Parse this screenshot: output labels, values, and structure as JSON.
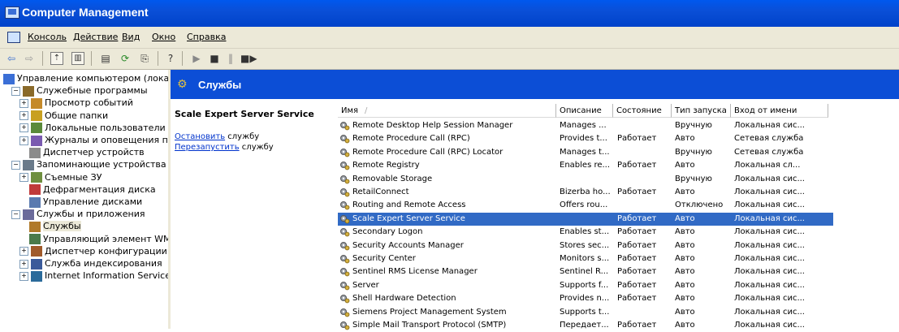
{
  "window": {
    "title": "Computer Management"
  },
  "menu": [
    "Консоль",
    "Действие",
    "Вид",
    "Окно",
    "Справка"
  ],
  "toolbar": {
    "icons": [
      "back-arrow-icon",
      "forward-arrow-icon",
      "up-folder-icon",
      "show-hide-tree-icon",
      "properties-icon",
      "refresh-icon",
      "export-list-icon",
      "help-icon",
      "play-icon",
      "stop-icon",
      "pause-icon",
      "restart-icon"
    ]
  },
  "tree": [
    {
      "label": "Управление компьютером (локаль",
      "indent": 0,
      "exp": ""
    },
    {
      "label": "Служебные программы",
      "indent": 1,
      "exp": "−"
    },
    {
      "label": "Просмотр событий",
      "indent": 2,
      "exp": "+"
    },
    {
      "label": "Общие папки",
      "indent": 2,
      "exp": "+"
    },
    {
      "label": "Локальные пользователи и",
      "indent": 2,
      "exp": "+"
    },
    {
      "label": "Журналы и оповещения пр",
      "indent": 2,
      "exp": "+"
    },
    {
      "label": "Диспетчер устройств",
      "indent": 2,
      "exp": ""
    },
    {
      "label": "Запоминающие устройства",
      "indent": 1,
      "exp": "−"
    },
    {
      "label": "Съемные ЗУ",
      "indent": 2,
      "exp": "+"
    },
    {
      "label": "Дефрагментация диска",
      "indent": 2,
      "exp": ""
    },
    {
      "label": "Управление дисками",
      "indent": 2,
      "exp": ""
    },
    {
      "label": "Службы и приложения",
      "indent": 1,
      "exp": "−"
    },
    {
      "label": "Службы",
      "indent": 2,
      "exp": "",
      "selected": true
    },
    {
      "label": "Управляющий элемент WM",
      "indent": 2,
      "exp": ""
    },
    {
      "label": "Диспетчер конфигурации S",
      "indent": 2,
      "exp": "+"
    },
    {
      "label": "Служба индексирования",
      "indent": 2,
      "exp": "+"
    },
    {
      "label": "Internet Information Service",
      "indent": 2,
      "exp": "+"
    }
  ],
  "header": {
    "title": "Службы"
  },
  "description": {
    "service_name": "Scale Expert Server Service",
    "stop_link": "Остановить",
    "stop_rest": " службу",
    "restart_link": "Перезапустить",
    "restart_rest": " службу"
  },
  "columns": [
    "Имя",
    "Описание",
    "Состояние",
    "Тип запуска",
    "Вход от имени"
  ],
  "services": [
    {
      "name": "Remote Desktop Help Session Manager",
      "desc": "Manages ...",
      "state": "",
      "startup": "Вручную",
      "logon": "Локальная сис..."
    },
    {
      "name": "Remote Procedure Call (RPC)",
      "desc": "Provides t...",
      "state": "Работает",
      "startup": "Авто",
      "logon": "Сетевая служба"
    },
    {
      "name": "Remote Procedure Call (RPC) Locator",
      "desc": "Manages t...",
      "state": "",
      "startup": "Вручную",
      "logon": "Сетевая служба"
    },
    {
      "name": "Remote Registry",
      "desc": "Enables re...",
      "state": "Работает",
      "startup": "Авто",
      "logon": "Локальная сл..."
    },
    {
      "name": "Removable Storage",
      "desc": "",
      "state": "",
      "startup": "Вручную",
      "logon": "Локальная сис..."
    },
    {
      "name": "RetailConnect",
      "desc": "Bizerba ho...",
      "state": "Работает",
      "startup": "Авто",
      "logon": "Локальная сис..."
    },
    {
      "name": "Routing and Remote Access",
      "desc": "Offers rou...",
      "state": "",
      "startup": "Отключено",
      "logon": "Локальная сис..."
    },
    {
      "name": "Scale Expert Server Service",
      "desc": "",
      "state": "Работает",
      "startup": "Авто",
      "logon": "Локальная сис...",
      "selected": true
    },
    {
      "name": "Secondary Logon",
      "desc": "Enables st...",
      "state": "Работает",
      "startup": "Авто",
      "logon": "Локальная сис..."
    },
    {
      "name": "Security Accounts Manager",
      "desc": "Stores sec...",
      "state": "Работает",
      "startup": "Авто",
      "logon": "Локальная сис..."
    },
    {
      "name": "Security Center",
      "desc": "Monitors s...",
      "state": "Работает",
      "startup": "Авто",
      "logon": "Локальная сис..."
    },
    {
      "name": "Sentinel RMS License Manager",
      "desc": "Sentinel R...",
      "state": "Работает",
      "startup": "Авто",
      "logon": "Локальная сис..."
    },
    {
      "name": "Server",
      "desc": "Supports f...",
      "state": "Работает",
      "startup": "Авто",
      "logon": "Локальная сис..."
    },
    {
      "name": "Shell Hardware Detection",
      "desc": "Provides n...",
      "state": "Работает",
      "startup": "Авто",
      "logon": "Локальная сис..."
    },
    {
      "name": "Siemens Project Management System",
      "desc": "Supports t...",
      "state": "",
      "startup": "Авто",
      "logon": "Локальная сис..."
    },
    {
      "name": "Simple Mail Transport Protocol (SMTP)",
      "desc": "Передает...",
      "state": "Работает",
      "startup": "Авто",
      "logon": "Локальная сис..."
    }
  ]
}
